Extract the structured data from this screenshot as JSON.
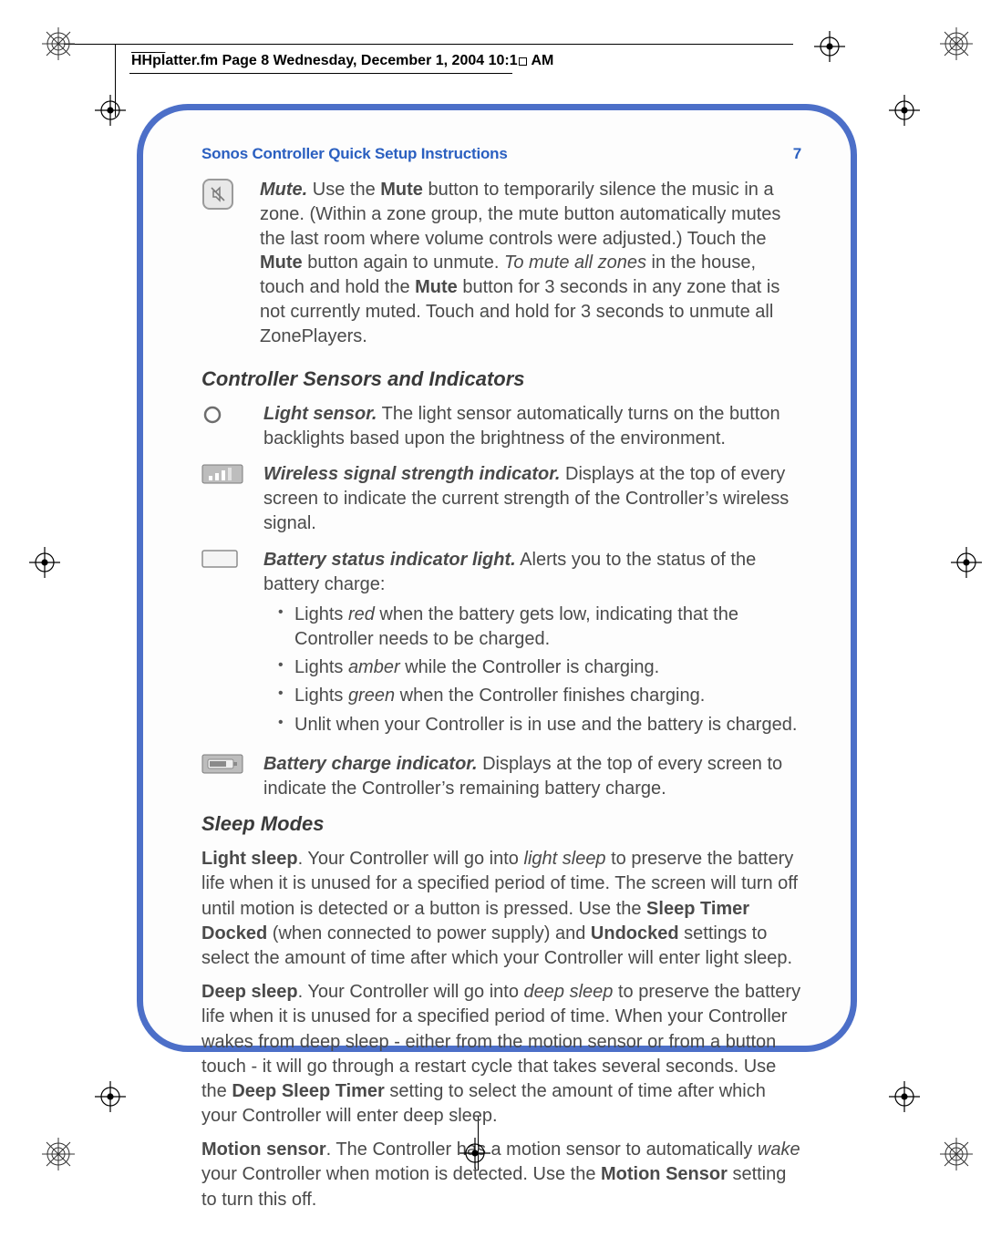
{
  "proof": {
    "text_prefix": "HHpl",
    "text_rest": "atter.fm  Page 8  Wednesday, December 1, 2004  10:1",
    "text_suffix": " AM"
  },
  "header": {
    "title": "Sonos Controller Quick Setup Instructions",
    "page_number": "7"
  },
  "mute": {
    "runin": "Mute.",
    "text1": " Use the ",
    "bold1": "Mute",
    "text2": " button to temporarily silence the music in a zone. (Within a zone group, the mute button automatically mutes the last room where volume controls were adjusted.) Touch the ",
    "bold2": "Mute",
    "text3": " button again to unmute. ",
    "italic1": "To mute all zones",
    "text4": " in the house, touch and hold the ",
    "bold3": "Mute",
    "text5": " button for 3 seconds in any zone that is not currently muted. Touch and hold for 3 seconds to unmute all ZonePlayers."
  },
  "sections": {
    "sensors": "Controller Sensors and Indicators",
    "sleep": "Sleep Modes"
  },
  "light_sensor": {
    "runin": "Light sensor.",
    "text": " The light sensor automatically turns on the button backlights based upon the brightness of the environment."
  },
  "wireless": {
    "runin": "Wireless signal strength indicator.",
    "text": " Displays at the top of every screen to indicate the current strength of the Controller’s wireless signal."
  },
  "battery_light": {
    "runin": "Battery status indicator light.",
    "text": " Alerts you to the status of the battery charge:",
    "bullets": {
      "b1": {
        "pre": "Lights ",
        "em": "red",
        "post": " when the battery gets low, indicating that the Controller needs to be charged."
      },
      "b2": {
        "pre": "Lights ",
        "em": "amber",
        "post": " while the Controller is charging."
      },
      "b3": {
        "pre": "Lights ",
        "em": "green",
        "post": " when the Controller finishes charging."
      },
      "b4": {
        "text": "Unlit when your Controller is in use and the battery is charged."
      }
    }
  },
  "battery_charge": {
    "runin": "Battery charge indicator.",
    "text": " Displays at the top of every screen to indicate the Controller’s remaining battery charge."
  },
  "light_sleep": {
    "bold_lead": "Light sleep",
    "t1": ". Your Controller will go into ",
    "em1": "light sleep",
    "t2": " to preserve the battery life when it is unused for a specified period of time. The screen will turn off until motion is detected or a button is pressed. Use the ",
    "b1": "Sleep Timer Docked",
    "t3": " (when connected to power supply) and ",
    "b2": "Undocked",
    "t4": " settings to select the amount of time after which your Controller will enter light sleep."
  },
  "deep_sleep": {
    "bold_lead": "Deep sleep",
    "t1": ". Your Controller will go into ",
    "em1": "deep sleep",
    "t2": " to preserve the battery life when it is unused for a specified period of time. When your Controller wakes from deep sleep - either from the motion sensor or from a button touch - it will go through a restart cycle that takes several seconds. Use the ",
    "b1": "Deep Sleep Timer",
    "t3": " setting to select the amount of time after which your Controller will enter deep sleep."
  },
  "motion": {
    "bold_lead": "Motion sensor",
    "t1": ". The Controller has a motion sensor to automatically ",
    "em1": "wake",
    "t2": " your Controller when motion is detected. Use the ",
    "b1": "Motion Sensor",
    "t3": " setting to turn this off."
  }
}
